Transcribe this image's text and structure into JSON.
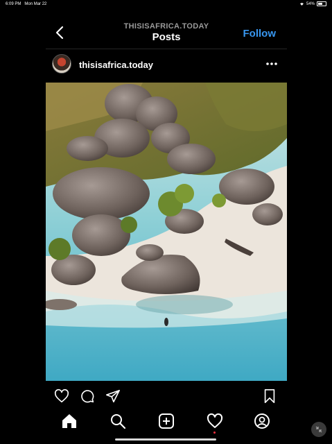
{
  "status_bar": {
    "time": "6:09 PM",
    "date": "Mon Mar 22",
    "battery": "54%"
  },
  "header": {
    "subtitle": "THISISAFRICA.TODAY",
    "title": "Posts",
    "follow_label": "Follow"
  },
  "post": {
    "username": "thisisafrica.today"
  },
  "colors": {
    "background": "#000000",
    "accent": "#3897f0",
    "divider": "#262626",
    "notification": "#ff3040"
  },
  "icons": {
    "back": "chevron-left-icon",
    "more": "more-horizontal-icon",
    "like": "heart-icon",
    "comment": "comment-icon",
    "share": "send-icon",
    "save": "bookmark-icon",
    "home": "home-icon",
    "search": "search-icon",
    "new_post": "add-post-icon",
    "activity": "heart-icon",
    "profile": "profile-icon"
  }
}
